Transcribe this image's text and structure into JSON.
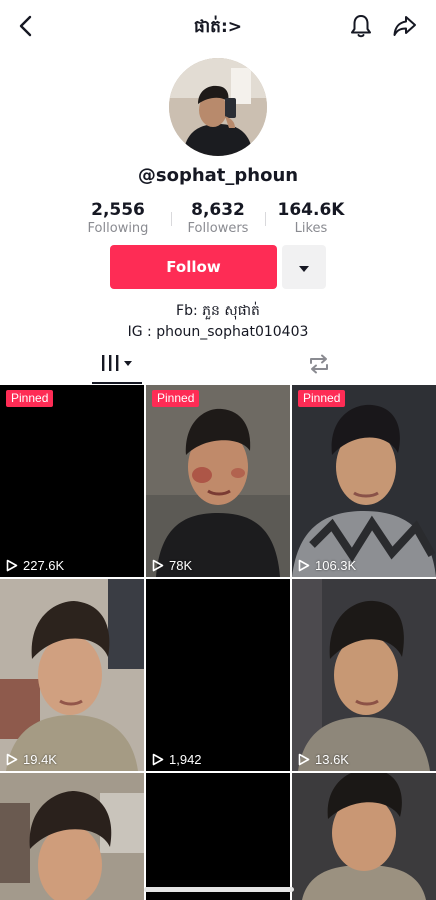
{
  "header": {
    "title": "ផាត់:>",
    "back_icon": "chevron-left-icon",
    "bell_icon": "bell-icon",
    "share_icon": "share-arrow-icon"
  },
  "profile": {
    "username": "@sophat_phoun",
    "stats": [
      {
        "value": "2,556",
        "label": "Following"
      },
      {
        "value": "8,632",
        "label": "Followers"
      },
      {
        "value": "164.6K",
        "label": "Likes"
      }
    ],
    "follow_label": "Follow",
    "bio_lines": [
      "Fb: ភួន សុផាត់",
      "IG : phoun_sophat010403"
    ]
  },
  "tabs": {
    "videos_icon": "grid-videos-icon",
    "repost_icon": "repost-icon"
  },
  "videos": [
    {
      "views": "227.6K",
      "pinned": true,
      "pinned_label": "Pinned"
    },
    {
      "views": "78K",
      "pinned": true,
      "pinned_label": "Pinned"
    },
    {
      "views": "106.3K",
      "pinned": true,
      "pinned_label": "Pinned"
    },
    {
      "views": "19.4K",
      "pinned": false
    },
    {
      "views": "1,942",
      "pinned": false
    },
    {
      "views": "13.6K",
      "pinned": false
    },
    {
      "views": "",
      "pinned": false
    },
    {
      "views": "",
      "pinned": false
    },
    {
      "views": "",
      "pinned": false
    }
  ],
  "colors": {
    "accent": "#fe2c55",
    "text": "#161823",
    "muted": "#8a8b91"
  }
}
